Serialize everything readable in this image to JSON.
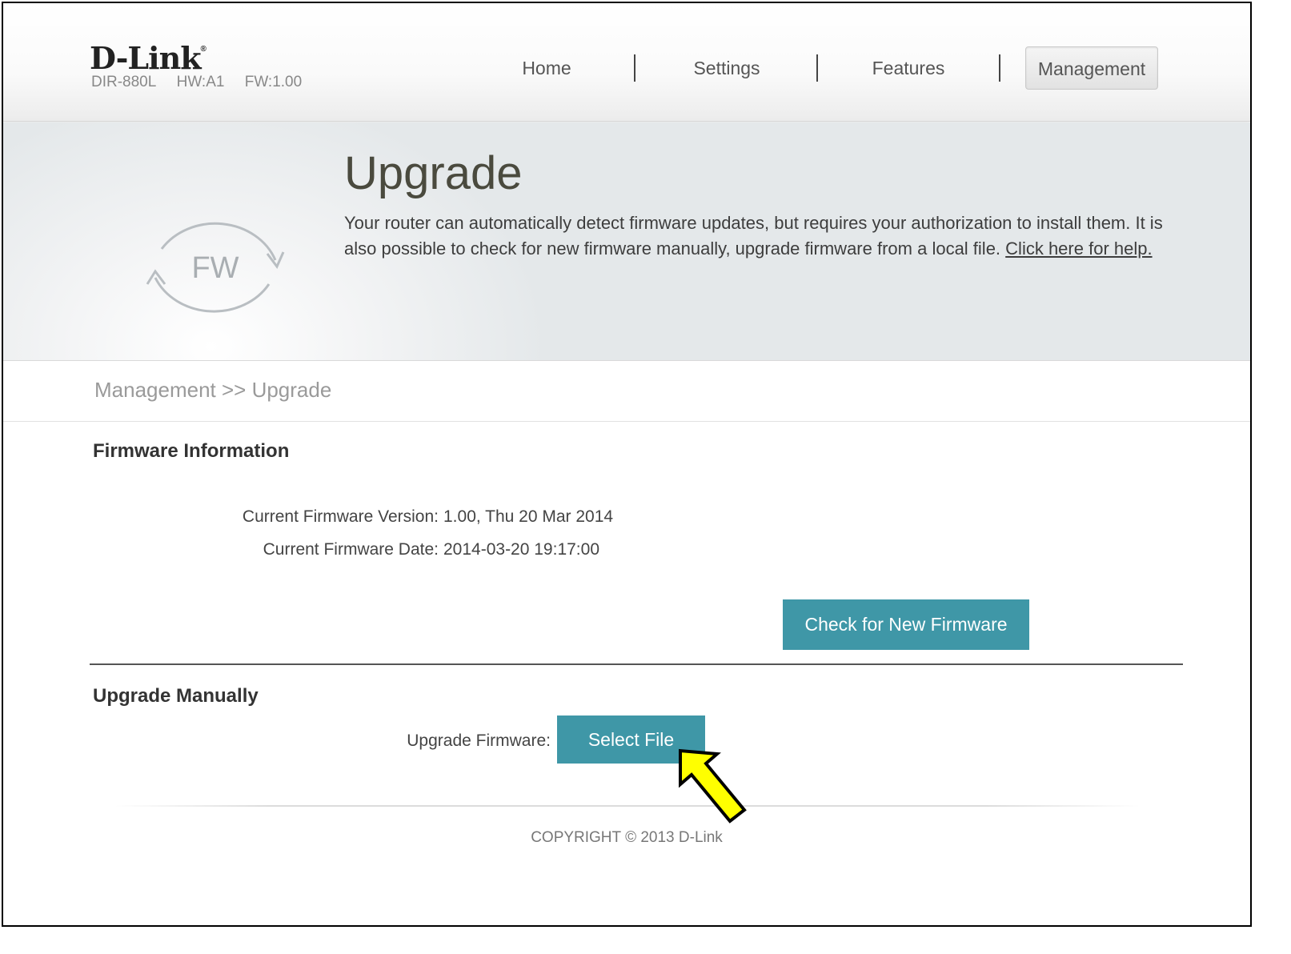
{
  "brand": {
    "logo": "D-Link",
    "registered_mark": "®",
    "model": "DIR-880L",
    "hw": "HW:A1",
    "fw": "FW:1.00"
  },
  "nav": {
    "items": [
      {
        "label": "Home"
      },
      {
        "label": "Settings"
      },
      {
        "label": "Features"
      },
      {
        "label": "Management"
      }
    ],
    "active": "Management"
  },
  "hero": {
    "icon": "fw-refresh-icon",
    "icon_text": "FW",
    "title": "Upgrade",
    "description": "Your router can automatically detect firmware updates, but requires your authorization to install them. It is also possible to check for new firmware manually, upgrade firmware from a local file.",
    "help_link": "Click here for help."
  },
  "breadcrumb": "Management >> Upgrade",
  "firmware_info": {
    "title": "Firmware Information",
    "version_label": "Current Firmware Version:",
    "version_value": "1.00, Thu 20 Mar 2014",
    "date_label": "Current Firmware Date:",
    "date_value": "2014-03-20 19:17:00",
    "check_button": "Check for New Firmware"
  },
  "upgrade_manually": {
    "title": "Upgrade Manually",
    "label": "Upgrade Firmware:",
    "select_button": "Select File"
  },
  "footer": {
    "copyright": "COPYRIGHT © 2013 D-Link"
  },
  "colors": {
    "button": "#3f97a7",
    "annotation_arrow": "#ffff00"
  }
}
